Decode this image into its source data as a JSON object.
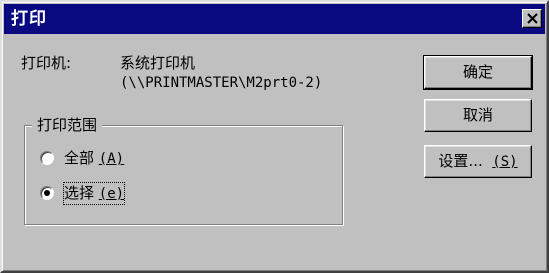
{
  "dialog": {
    "title": "打印",
    "close_label": "close"
  },
  "printer": {
    "label": "打印机:",
    "name": "系统打印机",
    "path": "(\\\\PRINTMASTER\\M2prt0-2)"
  },
  "range": {
    "title": "打印范围",
    "options": [
      {
        "label": "全部 ",
        "key": "(A)",
        "selected": false
      },
      {
        "label": "选择 ",
        "key": "(e)",
        "selected": true
      }
    ]
  },
  "buttons": {
    "ok": "确定",
    "cancel": "取消",
    "setup": "设置...  ",
    "setup_key": "(S)"
  },
  "colors": {
    "titlebar": "#0a0a80",
    "face": "#c0c0c0"
  }
}
